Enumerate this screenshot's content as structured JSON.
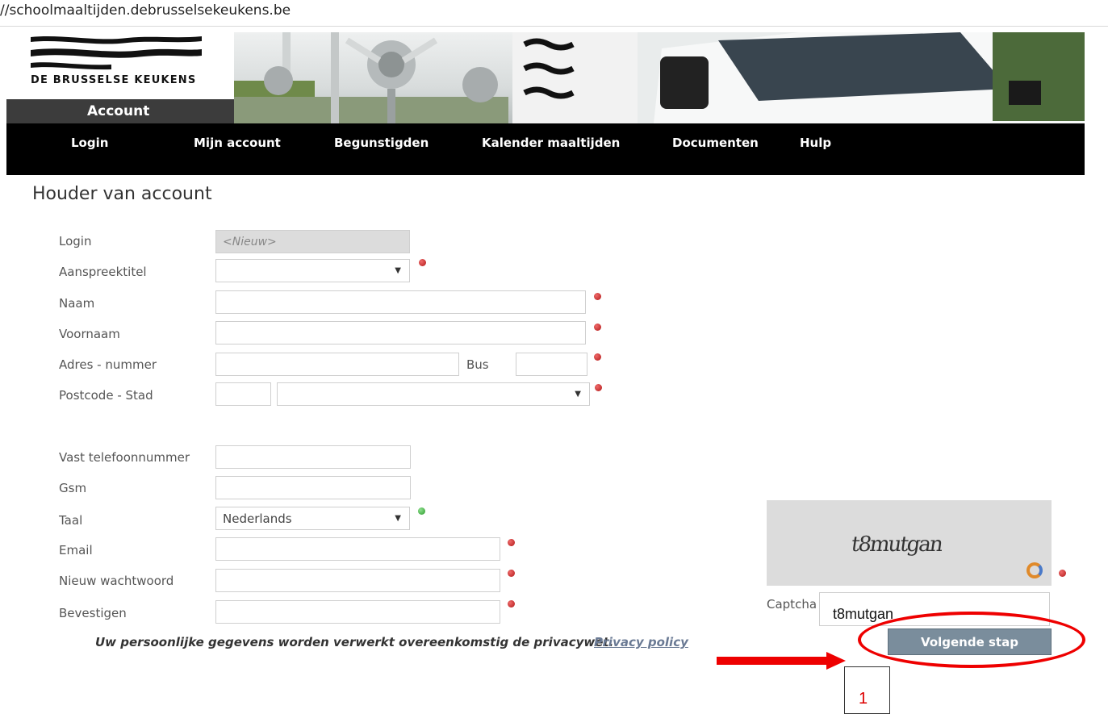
{
  "browser": {
    "url": "//schoolmaaltijden.debrusselsekeukens.be"
  },
  "brand": {
    "name": "DE BRUSSELSE KEUKENS",
    "section": "Account"
  },
  "nav": {
    "items": [
      "Login",
      "Mijn account",
      "Begunstigden",
      "Kalender maaltijden",
      "Documenten",
      "Hulp"
    ]
  },
  "page": {
    "title": "Houder van account"
  },
  "form": {
    "login_label": "Login",
    "login_value": "<Nieuw>",
    "title_label": "Aanspreektitel",
    "title_value": "",
    "naam_label": "Naam",
    "voornaam_label": "Voornaam",
    "adres_label": "Adres - nummer",
    "bus_label": "Bus",
    "postcode_label": "Postcode - Stad",
    "stad_value": "",
    "tel_label": "Vast telefoonnummer",
    "gsm_label": "Gsm",
    "taal_label": "Taal",
    "taal_value": "Nederlands",
    "email_label": "Email",
    "pw_label": "Nieuw wachtwoord",
    "confirm_label": "Bevestigen"
  },
  "privacy": {
    "text": "Uw persoonlijke gegevens worden verwerkt overeenkomstig de privacywet.",
    "link": "Privacy policy"
  },
  "captcha": {
    "image_text": "t8mutgan",
    "label": "Captcha",
    "value": "t8mutgan"
  },
  "buttons": {
    "next": "Volgende stap"
  },
  "annotation": {
    "step": "1"
  },
  "colors": {
    "required": "#c0392b",
    "valid": "#3cb043",
    "nav_bg": "#000000",
    "button": "#7a8d9c",
    "highlight": "#ee0000"
  }
}
